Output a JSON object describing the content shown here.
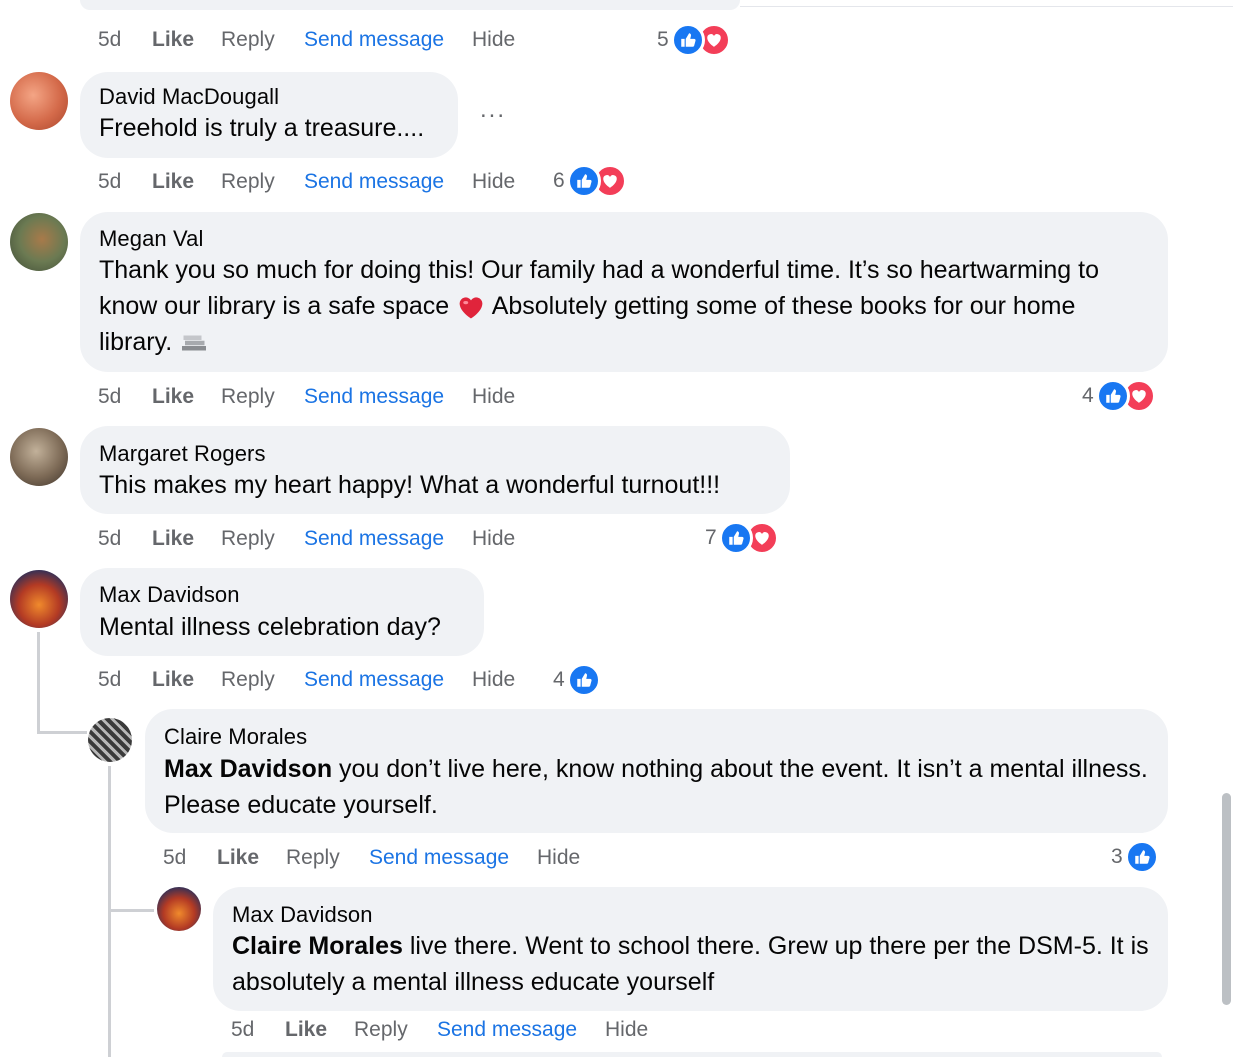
{
  "top": {
    "actions": {
      "time": "5d",
      "like": "Like",
      "reply": "Reply",
      "send": "Send message",
      "hide": "Hide"
    },
    "reaction_count": "5"
  },
  "comments": [
    {
      "author": "David MacDougall",
      "text": "Freehold is truly a treasure....",
      "more": "...",
      "actions": {
        "time": "5d",
        "like": "Like",
        "reply": "Reply",
        "send": "Send message",
        "hide": "Hide"
      },
      "reaction_count": "6"
    },
    {
      "author": "Megan Val",
      "text_part1": "Thank you so much for doing this! Our family had a wonderful time. It’s so heartwarming to know our library is a safe space",
      "text_part2": "Absolutely getting some of these books for our home library.",
      "actions": {
        "time": "5d",
        "like": "Like",
        "reply": "Reply",
        "send": "Send message",
        "hide": "Hide"
      },
      "reaction_count": "4"
    },
    {
      "author": "Margaret Rogers",
      "text": "This makes my heart happy! What a wonderful turnout!!!",
      "actions": {
        "time": "5d",
        "like": "Like",
        "reply": "Reply",
        "send": "Send message",
        "hide": "Hide"
      },
      "reaction_count": "7"
    },
    {
      "author": "Max Davidson",
      "text": "Mental illness celebration day?",
      "actions": {
        "time": "5d",
        "like": "Like",
        "reply": "Reply",
        "send": "Send message",
        "hide": "Hide"
      },
      "reaction_count": "4"
    }
  ],
  "replies": [
    {
      "author": "Claire Morales",
      "mention": "Max Davidson",
      "text": " you don’t live here, know nothing about the event. It isn’t a mental illness. Please educate yourself.",
      "actions": {
        "time": "5d",
        "like": "Like",
        "reply": "Reply",
        "send": "Send message",
        "hide": "Hide"
      },
      "reaction_count": "3"
    },
    {
      "author": "Max Davidson",
      "mention": "Claire Morales",
      "text": " live there. Went to school there. Grew up there per the DSM-5. It is absolutely a mental illness educate yourself",
      "actions": {
        "time": "5d",
        "like": "Like",
        "reply": "Reply",
        "send": "Send message",
        "hide": "Hide"
      }
    }
  ],
  "colors": {
    "link": "#1b74e4",
    "like": "#1877f2",
    "love": "#f33e58",
    "bubble": "#f0f2f5",
    "meta": "#65676b"
  },
  "icons": [
    "like-reaction-icon",
    "love-reaction-icon",
    "heart-emoji-icon",
    "books-emoji-icon",
    "more-options-icon"
  ]
}
